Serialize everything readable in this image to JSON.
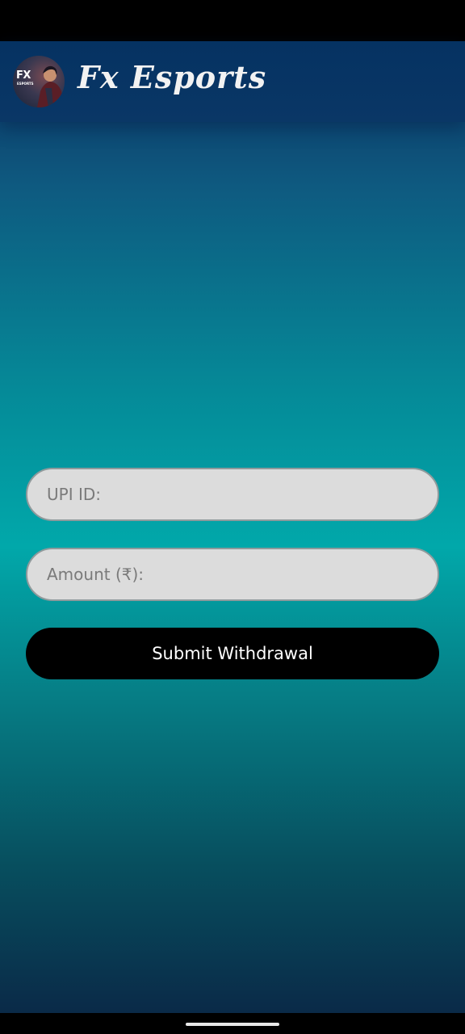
{
  "header": {
    "app_name": "Fx Esports",
    "logo_text": "FX",
    "logo_subtext": "ESPORTS"
  },
  "form": {
    "upi_placeholder": "UPI ID:",
    "upi_value": "",
    "amount_placeholder": "Amount (₹):",
    "amount_value": "",
    "submit_label": "Submit Withdrawal"
  },
  "colors": {
    "header_bg": "#053262",
    "field_bg": "#dcdcdc",
    "button_bg": "#000000",
    "button_text": "#ffffff"
  }
}
